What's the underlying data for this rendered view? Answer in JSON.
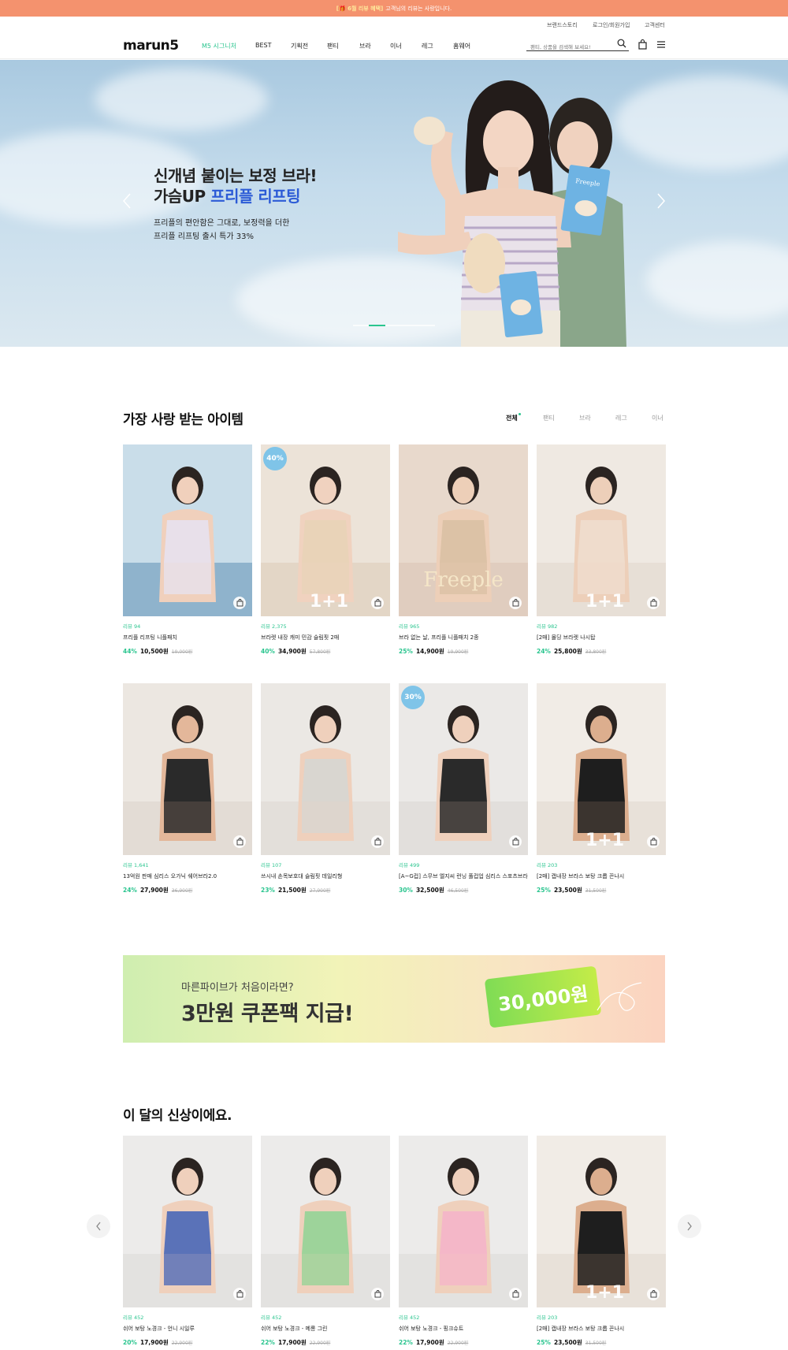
{
  "topbar": {
    "highlight": "[🎁 6월 리뷰 혜택] ",
    "text": "고객님의 리뷰는 사랑입니다."
  },
  "util": {
    "brand_story": "브랜드스토리",
    "login": "로그인/회원가입",
    "cs": "고객센터"
  },
  "header": {
    "logo": "marun5",
    "nav": [
      "M5 시그니처",
      "BEST",
      "기획전",
      "팬티",
      "브라",
      "이너",
      "레그",
      "홈웨어"
    ],
    "search_placeholder": "팬티, 상품을 검색해 보세요!"
  },
  "hero": {
    "line1": "신개념 붙이는 보정 브라!",
    "line2_prefix": "가슴UP ",
    "line2_highlight": "프리플 리프팅",
    "sub1": "프리플의 편안함은 그대로, 보정력을 더한",
    "sub2": "프리플 리프팅 출시 특가 33%",
    "product_text": "Freeple"
  },
  "best": {
    "title": "가장 사랑 받는 아이템",
    "tabs": [
      "전체",
      "팬티",
      "브라",
      "레그",
      "이너"
    ],
    "products": [
      {
        "review": "리뷰 94",
        "name": "프리플 리프팅 니플패치",
        "pct": "44%",
        "price": "10,500원",
        "old": "19,000원",
        "badge": "",
        "plus": ""
      },
      {
        "review": "리뷰 2,375",
        "name": "브라렛 내장 캐미 민감 슬림핏 2매",
        "pct": "40%",
        "price": "34,900원",
        "old": "57,800원",
        "badge": "40%",
        "plus": "1+1"
      },
      {
        "review": "리뷰 965",
        "name": "브라 없는 날, 프리플 니플패치 2종",
        "pct": "25%",
        "price": "14,900원",
        "old": "19,900원",
        "badge": "",
        "plus": "",
        "overlay": "Freeple"
      },
      {
        "review": "리뷰 982",
        "name": "[2매] 몰딩 브라렛 나시탑",
        "pct": "24%",
        "price": "25,800원",
        "old": "33,800원",
        "badge": "",
        "plus": "1+1"
      },
      {
        "review": "리뷰 1,641",
        "name": "13억원 판매 심리스 오가닉 쉐어브라2.0",
        "pct": "24%",
        "price": "27,900원",
        "old": "36,900원",
        "badge": "",
        "plus": ""
      },
      {
        "review": "리뷰 107",
        "name": "쓰시내 손목보호대 슬림핏 데일리형",
        "pct": "23%",
        "price": "21,500원",
        "old": "27,900원",
        "badge": "",
        "plus": ""
      },
      {
        "review": "리뷰 499",
        "name": "[A~G컵] 스무브 엘지씨 런닝 풀컵업 심리스 스포츠브라탑",
        "pct": "30%",
        "price": "32,500원",
        "old": "46,500원",
        "badge": "30%",
        "plus": ""
      },
      {
        "review": "리뷰 203",
        "name": "[2매] 캡내장 브라스 보탕 크롭 끈나시",
        "pct": "25%",
        "price": "23,500원",
        "old": "31,500원",
        "badge": "",
        "plus": "1+1"
      }
    ]
  },
  "coupon_banner": {
    "sub": "마른파이브가 처음이라면?",
    "title": "3만원 쿠폰팩 지급!",
    "amount": "30,000원"
  },
  "new": {
    "title": "이 달의 신상이에요.",
    "products": [
      {
        "review": "리뷰 452",
        "name": "쉬어 보탕 노경크 - 언니 시일루",
        "pct": "20%",
        "price": "17,900원",
        "old": "22,900원",
        "plus": ""
      },
      {
        "review": "리뷰 452",
        "name": "쉬어 보탕 노경크 - 메롱 그린",
        "pct": "22%",
        "price": "17,900원",
        "old": "22,900원",
        "plus": ""
      },
      {
        "review": "리뷰 452",
        "name": "쉬어 보탕 노경크 - 핑크슈트",
        "pct": "22%",
        "price": "17,900원",
        "old": "22,900원",
        "plus": ""
      },
      {
        "review": "리뷰 203",
        "name": "[2매] 캡내장 브라스 보탕 크롭 끈나시",
        "pct": "25%",
        "price": "23,500원",
        "old": "31,500원",
        "plus": "1+1"
      }
    ]
  },
  "colors": {
    "accent": "#2bc58f",
    "topbar": "#f4926e",
    "hero_blue": "#2c5bd6"
  }
}
